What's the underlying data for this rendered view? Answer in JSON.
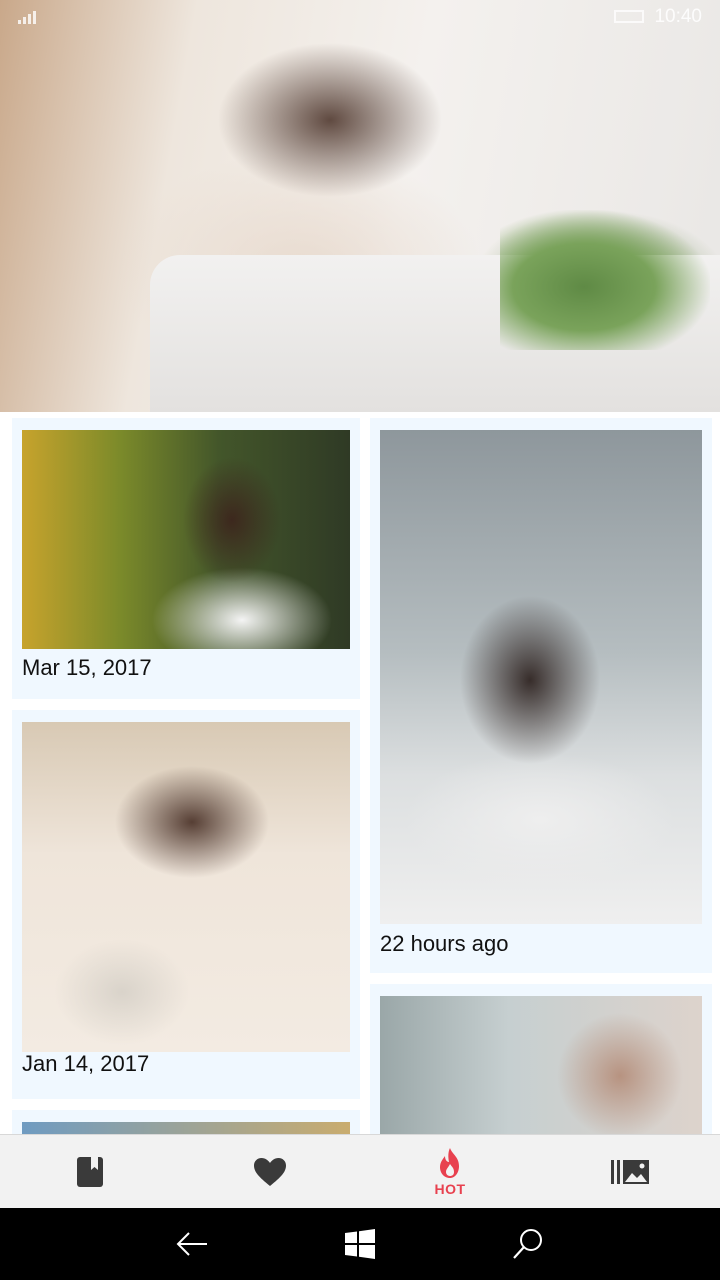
{
  "status_bar": {
    "time": "10:40"
  },
  "hero": {
    "image": "woman-on-bed-with-lilies"
  },
  "feed": {
    "cards": [
      {
        "date": "Mar 15, 2017",
        "image": "girl-polka-dot-shirt"
      },
      {
        "date": "22 hours ago",
        "image": "woman-on-bed-by-window"
      },
      {
        "date": "Jan 14, 2017",
        "image": "girl-with-cat"
      },
      {
        "date": "",
        "image": "woman-portrait"
      },
      {
        "date": "",
        "image": "photo-partial"
      }
    ]
  },
  "app_bar": {
    "tabs": [
      {
        "icon": "bookmark-book-icon",
        "label": ""
      },
      {
        "icon": "heart-icon",
        "label": ""
      },
      {
        "icon": "flame-icon",
        "label": "HOT",
        "active": true
      },
      {
        "icon": "gallery-icon",
        "label": ""
      }
    ],
    "active_color": "#e8414f",
    "icon_color": "#3a3a3a"
  },
  "nav_bar": {
    "buttons": [
      "back-arrow-icon",
      "windows-start-icon",
      "search-icon"
    ]
  }
}
